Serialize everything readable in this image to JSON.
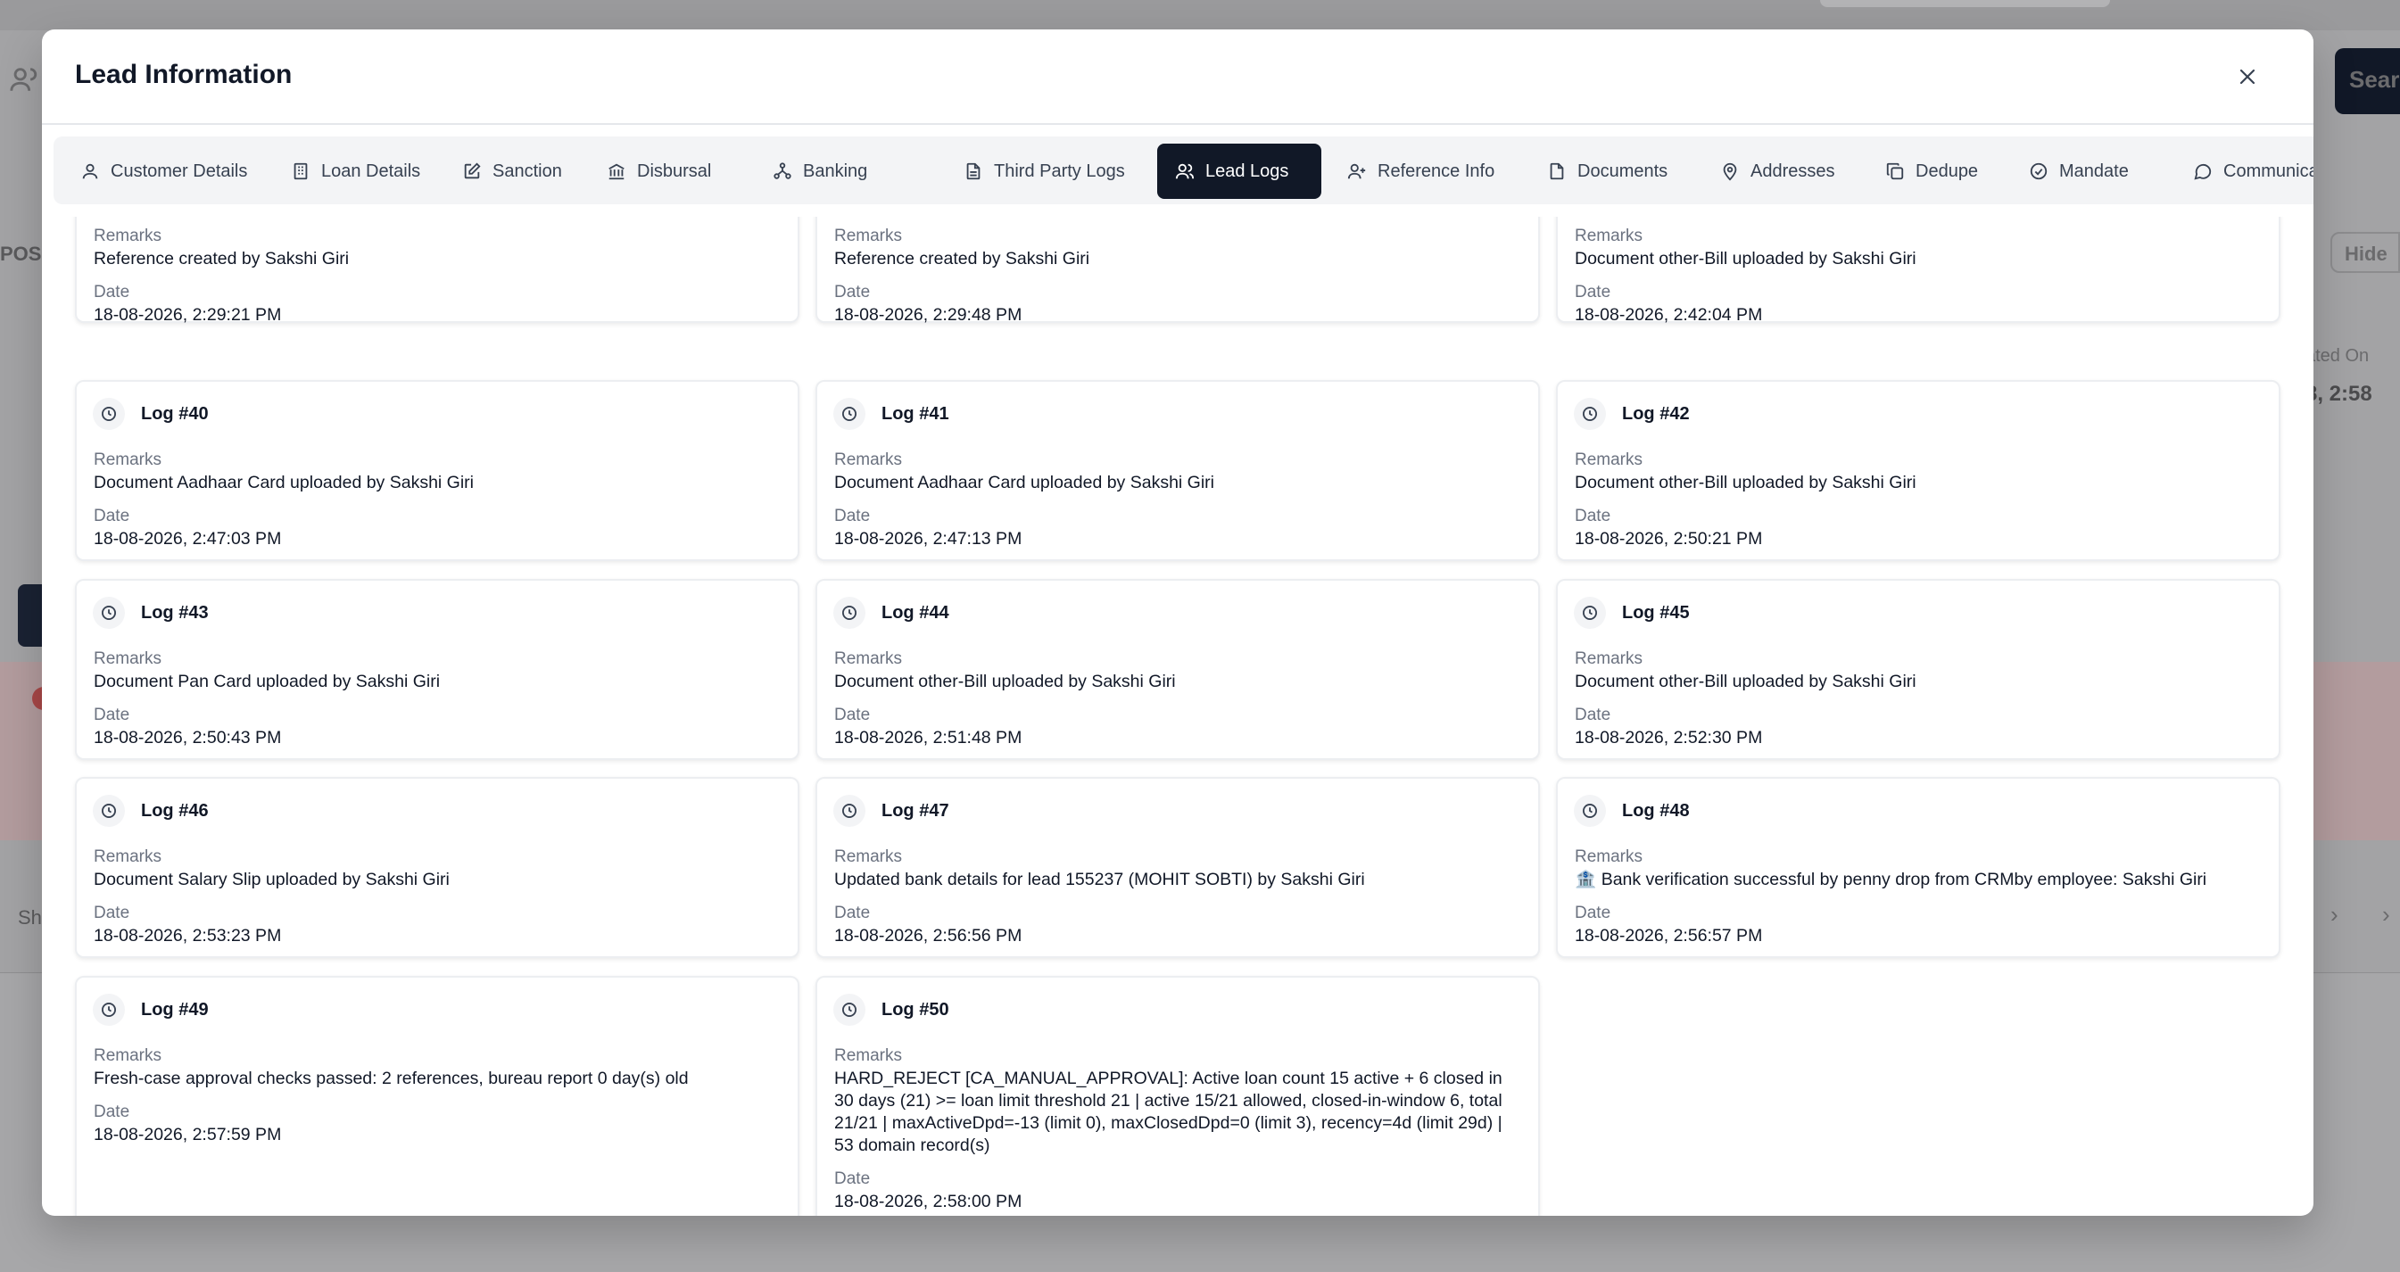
{
  "modal": {
    "title": "Lead Information"
  },
  "tabs": [
    {
      "label": "Customer Details",
      "icon": "user-icon"
    },
    {
      "label": "Loan Details",
      "icon": "building-icon"
    },
    {
      "label": "Sanction",
      "icon": "edit-icon"
    },
    {
      "label": "Disbursal",
      "icon": "bank-icon"
    },
    {
      "label": "Banking",
      "icon": "network-icon"
    },
    {
      "label": "Third Party Logs",
      "icon": "file-text-icon"
    },
    {
      "label": "Lead Logs",
      "icon": "users-icon",
      "active": true
    },
    {
      "label": "Reference Info",
      "icon": "user-plus-icon"
    },
    {
      "label": "Documents",
      "icon": "file-icon"
    },
    {
      "label": "Addresses",
      "icon": "map-pin-icon"
    },
    {
      "label": "Dedupe",
      "icon": "copy-icon"
    },
    {
      "label": "Mandate",
      "icon": "check-circle-icon"
    },
    {
      "label": "Communicati",
      "icon": "message-icon"
    }
  ],
  "field_labels": {
    "remarks": "Remarks",
    "date": "Date"
  },
  "partial_logs": [
    {
      "remarks": "Reference created by Sakshi Giri",
      "date": "18-08-2026, 2:29:21 PM"
    },
    {
      "remarks": "Reference created by Sakshi Giri",
      "date": "18-08-2026, 2:29:48 PM"
    },
    {
      "remarks": "Document other-Bill uploaded by Sakshi Giri",
      "date": "18-08-2026, 2:42:04 PM"
    }
  ],
  "logs": [
    {
      "title": "Log #40",
      "remarks": "Document Aadhaar Card uploaded by Sakshi Giri",
      "date": "18-08-2026, 2:47:03 PM"
    },
    {
      "title": "Log #41",
      "remarks": "Document Aadhaar Card uploaded by Sakshi Giri",
      "date": "18-08-2026, 2:47:13 PM"
    },
    {
      "title": "Log #42",
      "remarks": "Document other-Bill uploaded by Sakshi Giri",
      "date": "18-08-2026, 2:50:21 PM"
    },
    {
      "title": "Log #43",
      "remarks": "Document Pan Card uploaded by Sakshi Giri",
      "date": "18-08-2026, 2:50:43 PM"
    },
    {
      "title": "Log #44",
      "remarks": "Document other-Bill uploaded by Sakshi Giri",
      "date": "18-08-2026, 2:51:48 PM"
    },
    {
      "title": "Log #45",
      "remarks": "Document other-Bill uploaded by Sakshi Giri",
      "date": "18-08-2026, 2:52:30 PM"
    },
    {
      "title": "Log #46",
      "remarks": "Document Salary Slip uploaded by Sakshi Giri",
      "date": "18-08-2026, 2:53:23 PM"
    },
    {
      "title": "Log #47",
      "remarks": "Updated bank details for lead 155237 (MOHIT SOBTI) by Sakshi Giri",
      "date": "18-08-2026, 2:56:56 PM"
    },
    {
      "title": "Log #48",
      "remarks": "🏦 Bank verification successful by penny drop from CRMby employee: Sakshi Giri",
      "date": "18-08-2026, 2:56:57 PM"
    },
    {
      "title": "Log #49",
      "remarks": "Fresh-case approval checks passed: 2 references, bureau report 0 day(s) old",
      "date": "18-08-2026, 2:57:59 PM"
    },
    {
      "title": "Log #50",
      "remarks": "HARD_REJECT [CA_MANUAL_APPROVAL]: Active loan count 15 active + 6 closed in 30 days (21) >= loan limit threshold 21 | active 15/21 allowed, closed-in-window 6, total 21/21 | maxActiveDpd=-13 (limit 0), maxClosedDpd=0 (limit 3), recency=4d (limit 29d) | 53 domain record(s)",
      "date": "18-08-2026, 2:58:00 PM"
    }
  ],
  "background": {
    "pos_text": "POS",
    "sh_text": "Sh",
    "search_button_text": "Sear",
    "hide_button_text": "Hide",
    "column_label": "ated On",
    "column_value": "8, 2:58"
  },
  "colors": {
    "active_tab_bg": "#111827",
    "overlay": "#a3a3a5",
    "card_border": "#eceef1"
  }
}
